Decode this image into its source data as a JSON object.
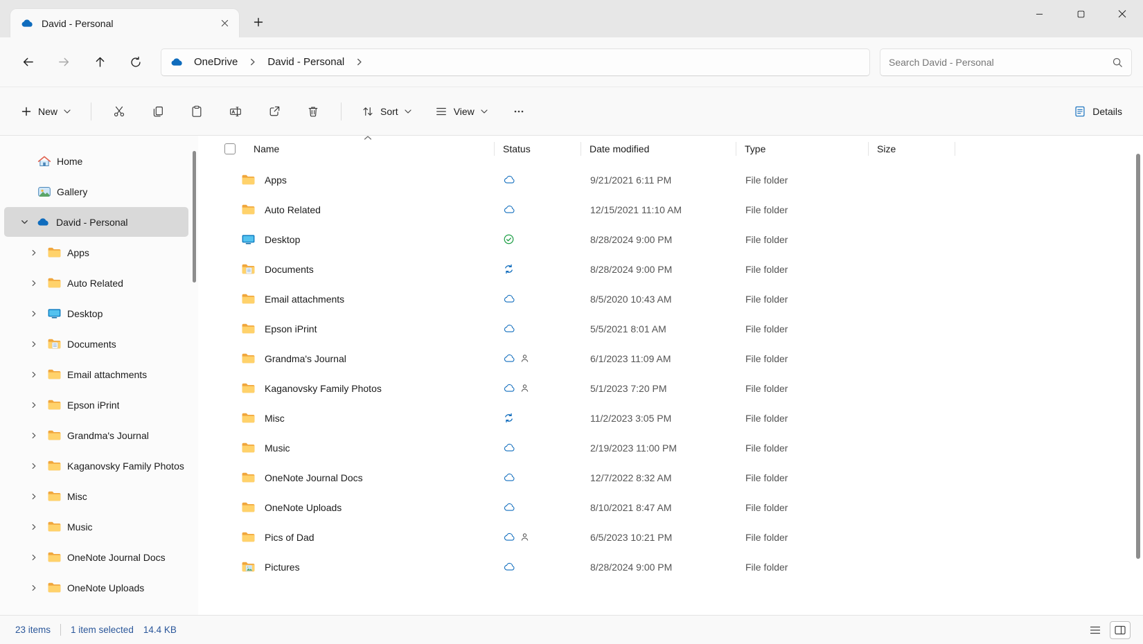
{
  "window": {
    "tab": {
      "title": "David - Personal"
    }
  },
  "navbar": {
    "breadcrumb": {
      "root": "OneDrive",
      "current": "David - Personal"
    },
    "search": {
      "placeholder": "Search David - Personal"
    }
  },
  "toolbar": {
    "new": "New",
    "sort": "Sort",
    "view": "View",
    "details": "Details"
  },
  "sidebar": {
    "items": [
      {
        "label": "Home",
        "icon": "home"
      },
      {
        "label": "Gallery",
        "icon": "gallery"
      },
      {
        "label": "David - Personal",
        "icon": "onedrive",
        "selected": true,
        "expander": "chevron-down"
      },
      {
        "label": "Apps",
        "icon": "folder",
        "indent": true,
        "expander": "chevron-right"
      },
      {
        "label": "Auto Related",
        "icon": "folder",
        "indent": true,
        "expander": "chevron-right"
      },
      {
        "label": "Desktop",
        "icon": "folder-desktop",
        "indent": true,
        "expander": "chevron-right"
      },
      {
        "label": "Documents",
        "icon": "folder-documents",
        "indent": true,
        "expander": "chevron-right"
      },
      {
        "label": "Email attachments",
        "icon": "folder",
        "indent": true,
        "expander": "chevron-right"
      },
      {
        "label": "Epson iPrint",
        "icon": "folder",
        "indent": true,
        "expander": "chevron-right"
      },
      {
        "label": "Grandma's Journal",
        "icon": "folder",
        "indent": true,
        "expander": "chevron-right"
      },
      {
        "label": "Kaganovsky Family Photos",
        "icon": "folder",
        "indent": true,
        "expander": "chevron-right"
      },
      {
        "label": "Misc",
        "icon": "folder",
        "indent": true,
        "expander": "chevron-right"
      },
      {
        "label": "Music",
        "icon": "folder",
        "indent": true,
        "expander": "chevron-right"
      },
      {
        "label": "OneNote Journal Docs",
        "icon": "folder",
        "indent": true,
        "expander": "chevron-right"
      },
      {
        "label": "OneNote Uploads",
        "icon": "folder",
        "indent": true,
        "expander": "chevron-right"
      }
    ]
  },
  "filelist": {
    "columns": {
      "name": "Name",
      "status": "Status",
      "modified": "Date modified",
      "type": "Type",
      "size": "Size"
    },
    "rows": [
      {
        "name": "Apps",
        "icon": "folder",
        "status": [
          "cloud"
        ],
        "modified": "9/21/2021 6:11 PM",
        "type": "File folder",
        "size": ""
      },
      {
        "name": "Auto Related",
        "icon": "folder",
        "status": [
          "cloud"
        ],
        "modified": "12/15/2021 11:10 AM",
        "type": "File folder",
        "size": ""
      },
      {
        "name": "Desktop",
        "icon": "folder-desktop",
        "status": [
          "synced"
        ],
        "modified": "8/28/2024 9:00 PM",
        "type": "File folder",
        "size": ""
      },
      {
        "name": "Documents",
        "icon": "folder-documents",
        "status": [
          "syncing"
        ],
        "modified": "8/28/2024 9:00 PM",
        "type": "File folder",
        "size": ""
      },
      {
        "name": "Email attachments",
        "icon": "folder",
        "status": [
          "cloud"
        ],
        "modified": "8/5/2020 10:43 AM",
        "type": "File folder",
        "size": ""
      },
      {
        "name": "Epson iPrint",
        "icon": "folder",
        "status": [
          "cloud"
        ],
        "modified": "5/5/2021 8:01 AM",
        "type": "File folder",
        "size": ""
      },
      {
        "name": "Grandma's Journal",
        "icon": "folder",
        "status": [
          "cloud",
          "people"
        ],
        "modified": "6/1/2023 11:09 AM",
        "type": "File folder",
        "size": ""
      },
      {
        "name": "Kaganovsky Family Photos",
        "icon": "folder",
        "status": [
          "cloud",
          "people"
        ],
        "modified": "5/1/2023 7:20 PM",
        "type": "File folder",
        "size": ""
      },
      {
        "name": "Misc",
        "icon": "folder",
        "status": [
          "syncing"
        ],
        "modified": "11/2/2023 3:05 PM",
        "type": "File folder",
        "size": ""
      },
      {
        "name": "Music",
        "icon": "folder",
        "status": [
          "cloud"
        ],
        "modified": "2/19/2023 11:00 PM",
        "type": "File folder",
        "size": ""
      },
      {
        "name": "OneNote Journal Docs",
        "icon": "folder",
        "status": [
          "cloud"
        ],
        "modified": "12/7/2022 8:32 AM",
        "type": "File folder",
        "size": ""
      },
      {
        "name": "OneNote Uploads",
        "icon": "folder",
        "status": [
          "cloud"
        ],
        "modified": "8/10/2021 8:47 AM",
        "type": "File folder",
        "size": ""
      },
      {
        "name": "Pics of Dad",
        "icon": "folder",
        "status": [
          "cloud",
          "people"
        ],
        "modified": "6/5/2023 10:21 PM",
        "type": "File folder",
        "size": ""
      },
      {
        "name": "Pictures",
        "icon": "folder-pictures",
        "status": [
          "cloud"
        ],
        "modified": "8/28/2024 9:00 PM",
        "type": "File folder",
        "size": ""
      }
    ]
  },
  "statusbar": {
    "count": "23 items",
    "selection": "1 item selected",
    "selection_size": "14.4 KB"
  },
  "colors": {
    "accent_blue": "#0f6cbd",
    "sync_green": "#1d9e45",
    "folder_yellow": "#ffd26b",
    "selected_sidebar": "#d9d9d9"
  }
}
